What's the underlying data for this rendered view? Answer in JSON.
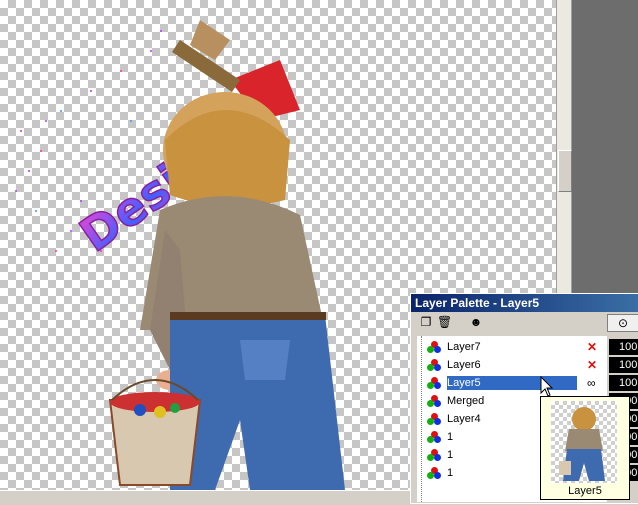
{
  "canvas": {
    "artwork_text": "Design",
    "layer_preview_caption": "Layer5"
  },
  "palette": {
    "title": "Layer Palette - Layer5",
    "toolbar": [
      {
        "icon": "new-layer-icon"
      },
      {
        "icon": "delete-layer-icon"
      },
      {
        "icon": "mask-icon"
      }
    ],
    "opacity_header_icon": "glasses-icon",
    "layers": [
      {
        "name": "Layer7",
        "opacity": "100",
        "visibility": "hidden",
        "selected": false
      },
      {
        "name": "Layer6",
        "opacity": "100",
        "visibility": "hidden",
        "selected": false
      },
      {
        "name": "Layer5",
        "opacity": "100",
        "visibility": "shown",
        "selected": true
      },
      {
        "name": "Merged",
        "opacity": "100",
        "visibility": "hidden",
        "selected": false
      },
      {
        "name": "Layer4",
        "opacity": "100",
        "visibility": "shown",
        "selected": false
      },
      {
        "name": "1",
        "opacity": "100",
        "visibility": "shown",
        "selected": false
      },
      {
        "name": "1",
        "opacity": "100",
        "visibility": "shown",
        "selected": false
      },
      {
        "name": "1",
        "opacity": "100",
        "visibility": "shown",
        "selected": false
      }
    ]
  },
  "colors": {
    "titlebar": "#0a246a",
    "selection": "#316ac5",
    "hidden_marker": "#e01010"
  }
}
